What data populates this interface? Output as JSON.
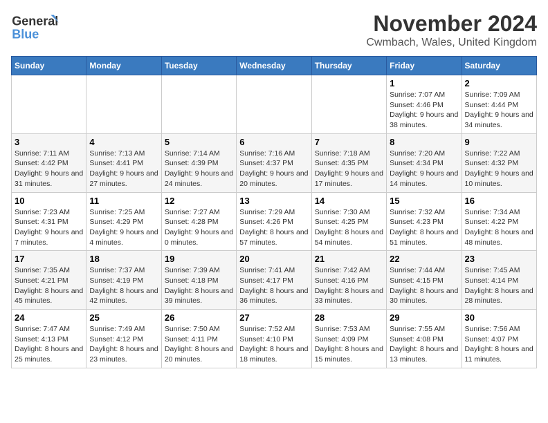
{
  "header": {
    "logo_line1": "General",
    "logo_line2": "Blue",
    "title": "November 2024",
    "subtitle": "Cwmbach, Wales, United Kingdom"
  },
  "days_of_week": [
    "Sunday",
    "Monday",
    "Tuesday",
    "Wednesday",
    "Thursday",
    "Friday",
    "Saturday"
  ],
  "weeks": [
    [
      {
        "day": "",
        "detail": ""
      },
      {
        "day": "",
        "detail": ""
      },
      {
        "day": "",
        "detail": ""
      },
      {
        "day": "",
        "detail": ""
      },
      {
        "day": "",
        "detail": ""
      },
      {
        "day": "1",
        "detail": "Sunrise: 7:07 AM\nSunset: 4:46 PM\nDaylight: 9 hours and 38 minutes."
      },
      {
        "day": "2",
        "detail": "Sunrise: 7:09 AM\nSunset: 4:44 PM\nDaylight: 9 hours and 34 minutes."
      }
    ],
    [
      {
        "day": "3",
        "detail": "Sunrise: 7:11 AM\nSunset: 4:42 PM\nDaylight: 9 hours and 31 minutes."
      },
      {
        "day": "4",
        "detail": "Sunrise: 7:13 AM\nSunset: 4:41 PM\nDaylight: 9 hours and 27 minutes."
      },
      {
        "day": "5",
        "detail": "Sunrise: 7:14 AM\nSunset: 4:39 PM\nDaylight: 9 hours and 24 minutes."
      },
      {
        "day": "6",
        "detail": "Sunrise: 7:16 AM\nSunset: 4:37 PM\nDaylight: 9 hours and 20 minutes."
      },
      {
        "day": "7",
        "detail": "Sunrise: 7:18 AM\nSunset: 4:35 PM\nDaylight: 9 hours and 17 minutes."
      },
      {
        "day": "8",
        "detail": "Sunrise: 7:20 AM\nSunset: 4:34 PM\nDaylight: 9 hours and 14 minutes."
      },
      {
        "day": "9",
        "detail": "Sunrise: 7:22 AM\nSunset: 4:32 PM\nDaylight: 9 hours and 10 minutes."
      }
    ],
    [
      {
        "day": "10",
        "detail": "Sunrise: 7:23 AM\nSunset: 4:31 PM\nDaylight: 9 hours and 7 minutes."
      },
      {
        "day": "11",
        "detail": "Sunrise: 7:25 AM\nSunset: 4:29 PM\nDaylight: 9 hours and 4 minutes."
      },
      {
        "day": "12",
        "detail": "Sunrise: 7:27 AM\nSunset: 4:28 PM\nDaylight: 9 hours and 0 minutes."
      },
      {
        "day": "13",
        "detail": "Sunrise: 7:29 AM\nSunset: 4:26 PM\nDaylight: 8 hours and 57 minutes."
      },
      {
        "day": "14",
        "detail": "Sunrise: 7:30 AM\nSunset: 4:25 PM\nDaylight: 8 hours and 54 minutes."
      },
      {
        "day": "15",
        "detail": "Sunrise: 7:32 AM\nSunset: 4:23 PM\nDaylight: 8 hours and 51 minutes."
      },
      {
        "day": "16",
        "detail": "Sunrise: 7:34 AM\nSunset: 4:22 PM\nDaylight: 8 hours and 48 minutes."
      }
    ],
    [
      {
        "day": "17",
        "detail": "Sunrise: 7:35 AM\nSunset: 4:21 PM\nDaylight: 8 hours and 45 minutes."
      },
      {
        "day": "18",
        "detail": "Sunrise: 7:37 AM\nSunset: 4:19 PM\nDaylight: 8 hours and 42 minutes."
      },
      {
        "day": "19",
        "detail": "Sunrise: 7:39 AM\nSunset: 4:18 PM\nDaylight: 8 hours and 39 minutes."
      },
      {
        "day": "20",
        "detail": "Sunrise: 7:41 AM\nSunset: 4:17 PM\nDaylight: 8 hours and 36 minutes."
      },
      {
        "day": "21",
        "detail": "Sunrise: 7:42 AM\nSunset: 4:16 PM\nDaylight: 8 hours and 33 minutes."
      },
      {
        "day": "22",
        "detail": "Sunrise: 7:44 AM\nSunset: 4:15 PM\nDaylight: 8 hours and 30 minutes."
      },
      {
        "day": "23",
        "detail": "Sunrise: 7:45 AM\nSunset: 4:14 PM\nDaylight: 8 hours and 28 minutes."
      }
    ],
    [
      {
        "day": "24",
        "detail": "Sunrise: 7:47 AM\nSunset: 4:13 PM\nDaylight: 8 hours and 25 minutes."
      },
      {
        "day": "25",
        "detail": "Sunrise: 7:49 AM\nSunset: 4:12 PM\nDaylight: 8 hours and 23 minutes."
      },
      {
        "day": "26",
        "detail": "Sunrise: 7:50 AM\nSunset: 4:11 PM\nDaylight: 8 hours and 20 minutes."
      },
      {
        "day": "27",
        "detail": "Sunrise: 7:52 AM\nSunset: 4:10 PM\nDaylight: 8 hours and 18 minutes."
      },
      {
        "day": "28",
        "detail": "Sunrise: 7:53 AM\nSunset: 4:09 PM\nDaylight: 8 hours and 15 minutes."
      },
      {
        "day": "29",
        "detail": "Sunrise: 7:55 AM\nSunset: 4:08 PM\nDaylight: 8 hours and 13 minutes."
      },
      {
        "day": "30",
        "detail": "Sunrise: 7:56 AM\nSunset: 4:07 PM\nDaylight: 8 hours and 11 minutes."
      }
    ]
  ]
}
